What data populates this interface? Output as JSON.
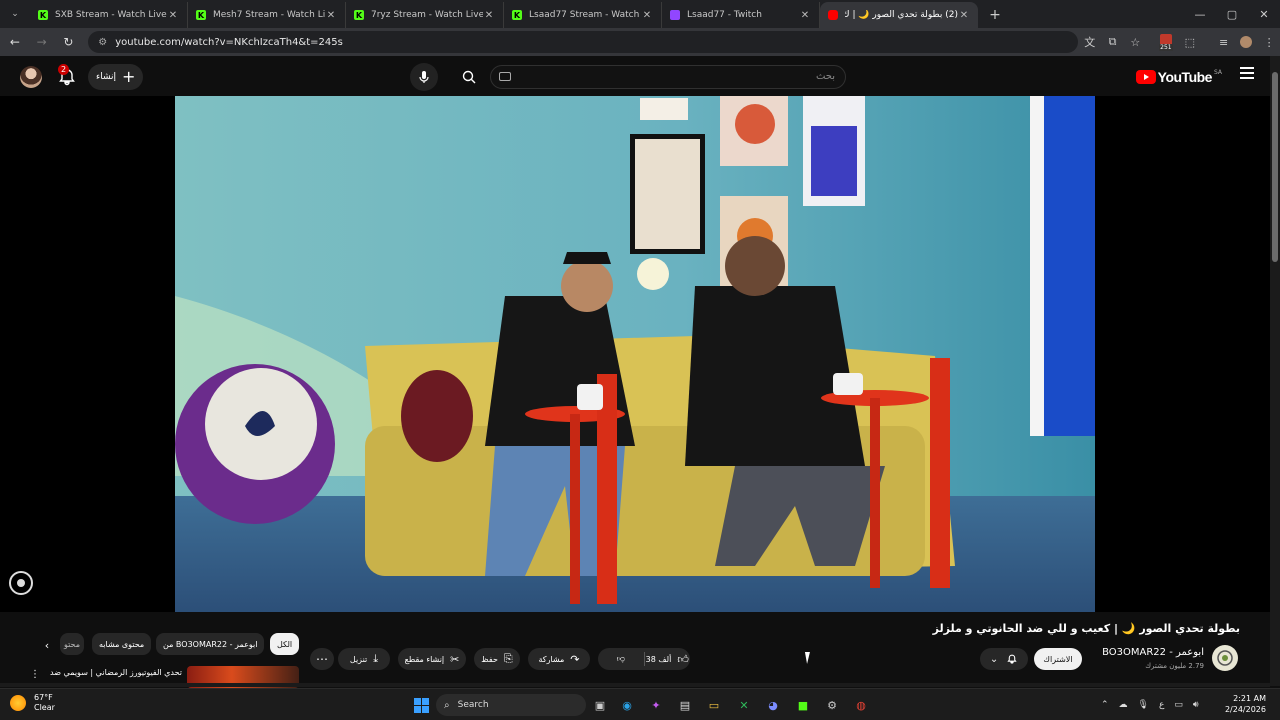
{
  "browser": {
    "tabs": [
      {
        "title": "SXB Stream - Watch Live on Ki",
        "icon": "kick-icon"
      },
      {
        "title": "Mesh7 Stream - Watch Live on",
        "icon": "kick-icon"
      },
      {
        "title": "7ryz Stream - Watch Live on Ki",
        "icon": "kick-icon"
      },
      {
        "title": "Lsaad77 Stream - Watch Live o",
        "icon": "kick-icon"
      },
      {
        "title": "Lsaad77 - Twitch",
        "icon": "twitch-icon"
      },
      {
        "title": "(2) بطولة تحدي الصور 🌙 | ك",
        "icon": "youtube-icon",
        "active": true
      }
    ],
    "url": "youtube.com/watch?v=NKchIzcaTh4&t=245s",
    "extension_badge": "251"
  },
  "youtube": {
    "logo_text": "YouTube",
    "region": "SA",
    "search_placeholder": "بحث",
    "create_label": "إنشاء",
    "notification_count": "2"
  },
  "video": {
    "title": "بطولة تحدي الصور 🌙 | كعيب و للي ضد الحانوتي و ملزلز",
    "channel": "ابوعمر - BO3OMAR22",
    "subscribers": "2.79 مليون مشترك",
    "subscribe_label": "الاشتراك",
    "likes": "38 ألف",
    "share_label": "مشاركة",
    "save_label": "حفظ",
    "clip_label": "إنشاء مقطع",
    "download_label": "تنزيل"
  },
  "chips": {
    "all": "الكل",
    "from_channel": "من BO3OMAR22 - ابوعمر",
    "related": "محتوى مشابه",
    "partial": "محتو"
  },
  "recommended": {
    "title": "تحدي الفيوتيورز الرمضاني | سويمي ضد"
  },
  "taskbar": {
    "temperature": "67°F",
    "condition": "Clear",
    "search_label": "Search",
    "time": "2:21 AM",
    "date": "2/24/2026",
    "lang": "ع"
  },
  "colors": {
    "yt_red": "#ff0000",
    "background": "#0f0f0f",
    "kick_green": "#53fc18",
    "twitch_purple": "#9146ff"
  }
}
